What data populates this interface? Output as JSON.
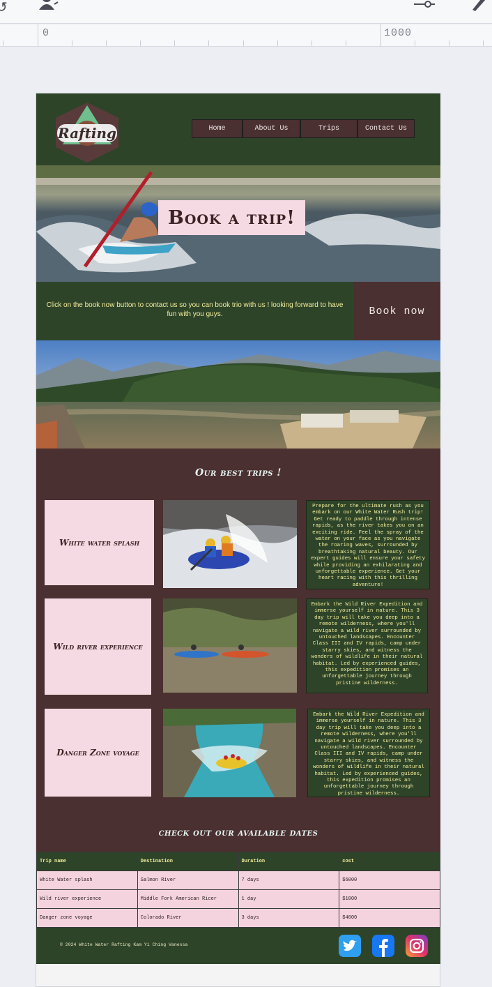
{
  "editor": {
    "ruler_start": "0",
    "ruler_end": "1000"
  },
  "site": {
    "logo_text": "Rafting",
    "nav": [
      "Home",
      "About Us",
      "Trips",
      "Contact Us"
    ],
    "hero_title": "Book a trip!",
    "book_text": "Click on the book now button to contact us so you can book trio with us ! looking forward to have fun with you guys.",
    "book_button": "Book now",
    "trips_title": "Our best trips !",
    "trips": [
      {
        "name": "White water splash",
        "description": "Prepare for the ultimate rush as you embark on our White Water Rush trip! Get ready to paddle through intense rapids, as the river takes you on an exciting ride. Feel the spray of the water on your face as you navigate the roaring waves, surrounded by breathtaking natural beauty. Our expert guides will ensure your safety while providing an exhilarating and unforgettable experience. Get your heart racing with this thrilling adventure!"
      },
      {
        "name": "Wild river experience",
        "description": "Embark the Wild River Expedition and immerse yourself in nature. This 3 day trip will take you deep into a remote wilderness, where you'll navigate a wild river surrounded by untouched landscapes. Encounter Class III and IV rapids, camp under starry skies, and witness the wonders of wildlife in their natural habitat. Led by experienced guides, this expedition promises an unforgettable journey through pristine wilderness."
      },
      {
        "name": "Danger Zone voyage",
        "description": "Embark the Wild River Expedition and immerse yourself in nature. This 3 day trip will take you deep into a remote wilderness, where you'll navigate a wild river surrounded by untouched landscapes. Encounter Class III and IV rapids, camp under starry skies, and witness the wonders of wildlife in their natural habitat. Led by experienced guides, this expedition promises an unforgettable journey through pristine wilderness."
      }
    ],
    "dates_title": "check out our available dates",
    "table": {
      "headers": [
        "Trip name",
        "Destination",
        "Duration",
        "cost"
      ],
      "rows": [
        [
          "White Water splash",
          "Salmon River",
          "7 days",
          "$6000"
        ],
        [
          "Wild river experience",
          "Middle Fork American Ricer",
          "1 day",
          "$1000"
        ],
        [
          "Danger zone voyage",
          "Colorado River",
          "3 days",
          "$4000"
        ]
      ]
    },
    "footer_text": "© 2024 White Water Rafting Kam Yi Ching Vanessa",
    "social_icons": [
      "twitter-icon",
      "facebook-icon",
      "instagram-icon"
    ]
  },
  "colors": {
    "forest_green": "#2e4429",
    "maroon": "#4a3030",
    "pink": "#f5d9e3",
    "yellow_text": "#f4ee9c"
  }
}
